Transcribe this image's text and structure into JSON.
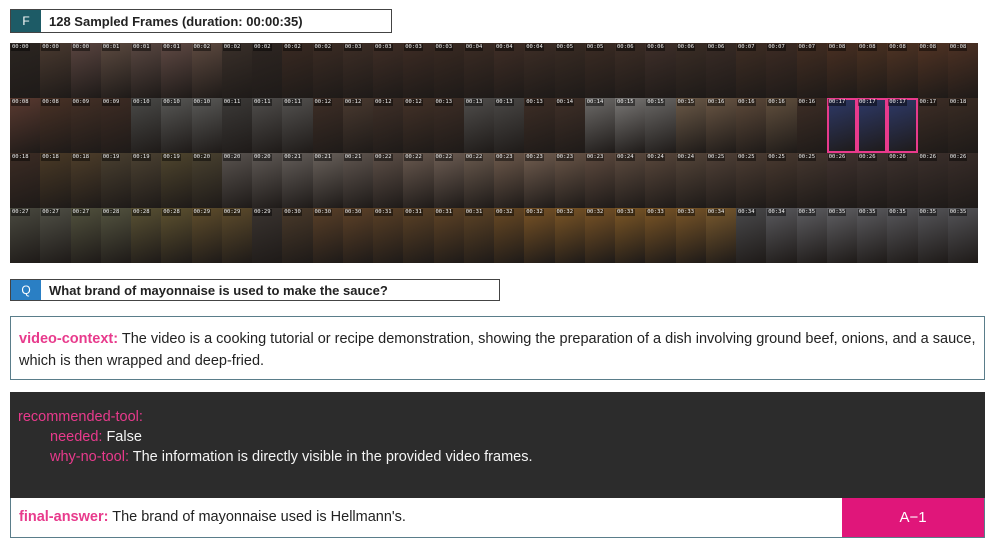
{
  "frames_header": {
    "letter": "F",
    "title": "128 Sampled Frames (duration: 00:00:35)"
  },
  "frames": [
    {
      "ts": "00:00",
      "c": "#2b2521"
    },
    {
      "ts": "00:00",
      "c": "#4a3a30"
    },
    {
      "ts": "00:00",
      "c": "#5a4540"
    },
    {
      "ts": "00:01",
      "c": "#5c4a40"
    },
    {
      "ts": "00:01",
      "c": "#5a4842"
    },
    {
      "ts": "00:01",
      "c": "#604a44"
    },
    {
      "ts": "00:02",
      "c": "#5e4a40"
    },
    {
      "ts": "00:02",
      "c": "#3a302a"
    },
    {
      "ts": "00:02",
      "c": "#2e2622"
    },
    {
      "ts": "00:02",
      "c": "#3a2a22"
    },
    {
      "ts": "00:02",
      "c": "#3c2c24"
    },
    {
      "ts": "00:03",
      "c": "#3e2e26"
    },
    {
      "ts": "00:03",
      "c": "#402e26"
    },
    {
      "ts": "00:03",
      "c": "#3e2c24"
    },
    {
      "ts": "00:03",
      "c": "#3a2a22"
    },
    {
      "ts": "00:04",
      "c": "#3c2c24"
    },
    {
      "ts": "00:04",
      "c": "#402e26"
    },
    {
      "ts": "00:04",
      "c": "#3e2e26"
    },
    {
      "ts": "00:05",
      "c": "#3a2c24"
    },
    {
      "ts": "00:05",
      "c": "#3c2c24"
    },
    {
      "ts": "00:06",
      "c": "#3e2e26"
    },
    {
      "ts": "00:06",
      "c": "#40302a"
    },
    {
      "ts": "00:06",
      "c": "#3c2e26"
    },
    {
      "ts": "00:06",
      "c": "#3a2c26"
    },
    {
      "ts": "00:07",
      "c": "#402e24"
    },
    {
      "ts": "00:07",
      "c": "#3e2c24"
    },
    {
      "ts": "00:07",
      "c": "#442e22"
    },
    {
      "ts": "00:08",
      "c": "#4a3022"
    },
    {
      "ts": "00:08",
      "c": "#4c3222"
    },
    {
      "ts": "00:08",
      "c": "#503424"
    },
    {
      "ts": "00:08",
      "c": "#523424"
    },
    {
      "ts": "00:08",
      "c": "#4e3224"
    },
    {
      "ts": "00:08",
      "c": "#5a3a30"
    },
    {
      "ts": "00:08",
      "c": "#4a3226"
    },
    {
      "ts": "00:09",
      "c": "#443026"
    },
    {
      "ts": "00:09",
      "c": "#3e2c24"
    },
    {
      "ts": "00:10",
      "c": "#4a4a48"
    },
    {
      "ts": "00:10",
      "c": "#585856"
    },
    {
      "ts": "00:10",
      "c": "#5a5a58"
    },
    {
      "ts": "00:11",
      "c": "#3c3a38"
    },
    {
      "ts": "00:11",
      "c": "#504e4c"
    },
    {
      "ts": "00:11",
      "c": "#545250"
    },
    {
      "ts": "00:12",
      "c": "#3e2e26"
    },
    {
      "ts": "00:12",
      "c": "#4a3a30"
    },
    {
      "ts": "00:12",
      "c": "#403028"
    },
    {
      "ts": "00:12",
      "c": "#443228"
    },
    {
      "ts": "00:13",
      "c": "#3e2e26"
    },
    {
      "ts": "00:13",
      "c": "#504e4c"
    },
    {
      "ts": "00:13",
      "c": "#4a4846"
    },
    {
      "ts": "00:13",
      "c": "#3e2e26"
    },
    {
      "ts": "00:14",
      "c": "#403028"
    },
    {
      "ts": "00:14",
      "c": "#6e6c6a"
    },
    {
      "ts": "00:15",
      "c": "#7a7876"
    },
    {
      "ts": "00:15",
      "c": "#6a6866"
    },
    {
      "ts": "00:15",
      "c": "#6c5a48"
    },
    {
      "ts": "00:16",
      "c": "#6a5644"
    },
    {
      "ts": "00:16",
      "c": "#5e4a3a"
    },
    {
      "ts": "00:16",
      "c": "#62503e"
    },
    {
      "ts": "00:16",
      "c": "#3e2e26"
    },
    {
      "ts": "00:17",
      "c": "#2e3a6a",
      "hl": true
    },
    {
      "ts": "00:17",
      "c": "#2e3a6a",
      "hl": true
    },
    {
      "ts": "00:17",
      "c": "#2e3a6a",
      "hl": true
    },
    {
      "ts": "00:17",
      "c": "#3e2e26"
    },
    {
      "ts": "00:18",
      "c": "#3a2c24"
    },
    {
      "ts": "00:18",
      "c": "#3c2c24"
    },
    {
      "ts": "00:18",
      "c": "#4a3a26"
    },
    {
      "ts": "00:18",
      "c": "#4e3e2a"
    },
    {
      "ts": "00:19",
      "c": "#4a4030"
    },
    {
      "ts": "00:19",
      "c": "#4c4232"
    },
    {
      "ts": "00:19",
      "c": "#50462e"
    },
    {
      "ts": "00:20",
      "c": "#4a4230"
    },
    {
      "ts": "00:20",
      "c": "#5a5450"
    },
    {
      "ts": "00:20",
      "c": "#605a56"
    },
    {
      "ts": "00:21",
      "c": "#645e5a"
    },
    {
      "ts": "00:21",
      "c": "#6a625c"
    },
    {
      "ts": "00:21",
      "c": "#605650"
    },
    {
      "ts": "00:22",
      "c": "#5e5048"
    },
    {
      "ts": "00:22",
      "c": "#6a5a50"
    },
    {
      "ts": "00:22",
      "c": "#6e5e54"
    },
    {
      "ts": "00:22",
      "c": "#6a5a4e"
    },
    {
      "ts": "00:23",
      "c": "#6e5a4c"
    },
    {
      "ts": "00:23",
      "c": "#725e50"
    },
    {
      "ts": "00:23",
      "c": "#6a5648"
    },
    {
      "ts": "00:23",
      "c": "#604c40"
    },
    {
      "ts": "00:24",
      "c": "#5e4c40"
    },
    {
      "ts": "00:24",
      "c": "#5a483c"
    },
    {
      "ts": "00:24",
      "c": "#56463a"
    },
    {
      "ts": "00:25",
      "c": "#524238"
    },
    {
      "ts": "00:25",
      "c": "#4e3e34"
    },
    {
      "ts": "00:25",
      "c": "#4a3a30"
    },
    {
      "ts": "00:25",
      "c": "#463830"
    },
    {
      "ts": "00:26",
      "c": "#423430"
    },
    {
      "ts": "00:26",
      "c": "#403430"
    },
    {
      "ts": "00:26",
      "c": "#3e322e"
    },
    {
      "ts": "00:26",
      "c": "#3c302c"
    },
    {
      "ts": "00:26",
      "c": "#3a2e2a"
    },
    {
      "ts": "00:27",
      "c": "#4a4a40"
    },
    {
      "ts": "00:27",
      "c": "#505046"
    },
    {
      "ts": "00:27",
      "c": "#52523e"
    },
    {
      "ts": "00:28",
      "c": "#545440"
    },
    {
      "ts": "00:28",
      "c": "#5a5234"
    },
    {
      "ts": "00:28",
      "c": "#5e5230"
    },
    {
      "ts": "00:29",
      "c": "#604e2c"
    },
    {
      "ts": "00:29",
      "c": "#5e4c2c"
    },
    {
      "ts": "00:29",
      "c": "#3a3430"
    },
    {
      "ts": "00:30",
      "c": "#4a3a2a"
    },
    {
      "ts": "00:30",
      "c": "#5a4028"
    },
    {
      "ts": "00:30",
      "c": "#5e4228"
    },
    {
      "ts": "00:31",
      "c": "#5a4026"
    },
    {
      "ts": "00:31",
      "c": "#5c4226"
    },
    {
      "ts": "00:31",
      "c": "#604426"
    },
    {
      "ts": "00:31",
      "c": "#5e4426"
    },
    {
      "ts": "00:32",
      "c": "#6a4a24"
    },
    {
      "ts": "00:32",
      "c": "#7a5426"
    },
    {
      "ts": "00:32",
      "c": "#7c5626"
    },
    {
      "ts": "00:32",
      "c": "#7a5426"
    },
    {
      "ts": "00:33",
      "c": "#7e5826"
    },
    {
      "ts": "00:33",
      "c": "#7c5626"
    },
    {
      "ts": "00:33",
      "c": "#7a5628"
    },
    {
      "ts": "00:34",
      "c": "#7a5a2e"
    },
    {
      "ts": "00:34",
      "c": "#4a4a4c"
    },
    {
      "ts": "00:34",
      "c": "#5a5a5e"
    },
    {
      "ts": "00:35",
      "c": "#5e5e62"
    },
    {
      "ts": "00:35",
      "c": "#606064"
    },
    {
      "ts": "00:35",
      "c": "#5c5c60"
    },
    {
      "ts": "00:35",
      "c": "#58585c"
    },
    {
      "ts": "00:35",
      "c": "#56565a"
    },
    {
      "ts": "00:35",
      "c": "#545458"
    }
  ],
  "question_box": {
    "letter": "Q",
    "text": "What brand of mayonnaise is used to make the sauce?"
  },
  "video_context": {
    "label": "video-context:",
    "text": "The video is a cooking tutorial or recipe demonstration, showing the preparation of a dish involving ground beef, onions, and a sauce, which is then wrapped and deep-fried."
  },
  "recommended_tool": {
    "label": "recommended-tool:",
    "needed_key": "needed:",
    "needed_value": "False",
    "why_key": "why-no-tool:",
    "why_value": "The information is directly visible in the provided video frames."
  },
  "final_answer": {
    "label": "final-answer:",
    "text": "The brand of mayonnaise used is Hellmann's.",
    "badge": "A−1"
  },
  "colors": {
    "accent_pink": "#e83a8c",
    "header_teal": "#1d5b66",
    "question_blue": "#2a7fc4",
    "dark_panel": "#2c2c2c"
  }
}
